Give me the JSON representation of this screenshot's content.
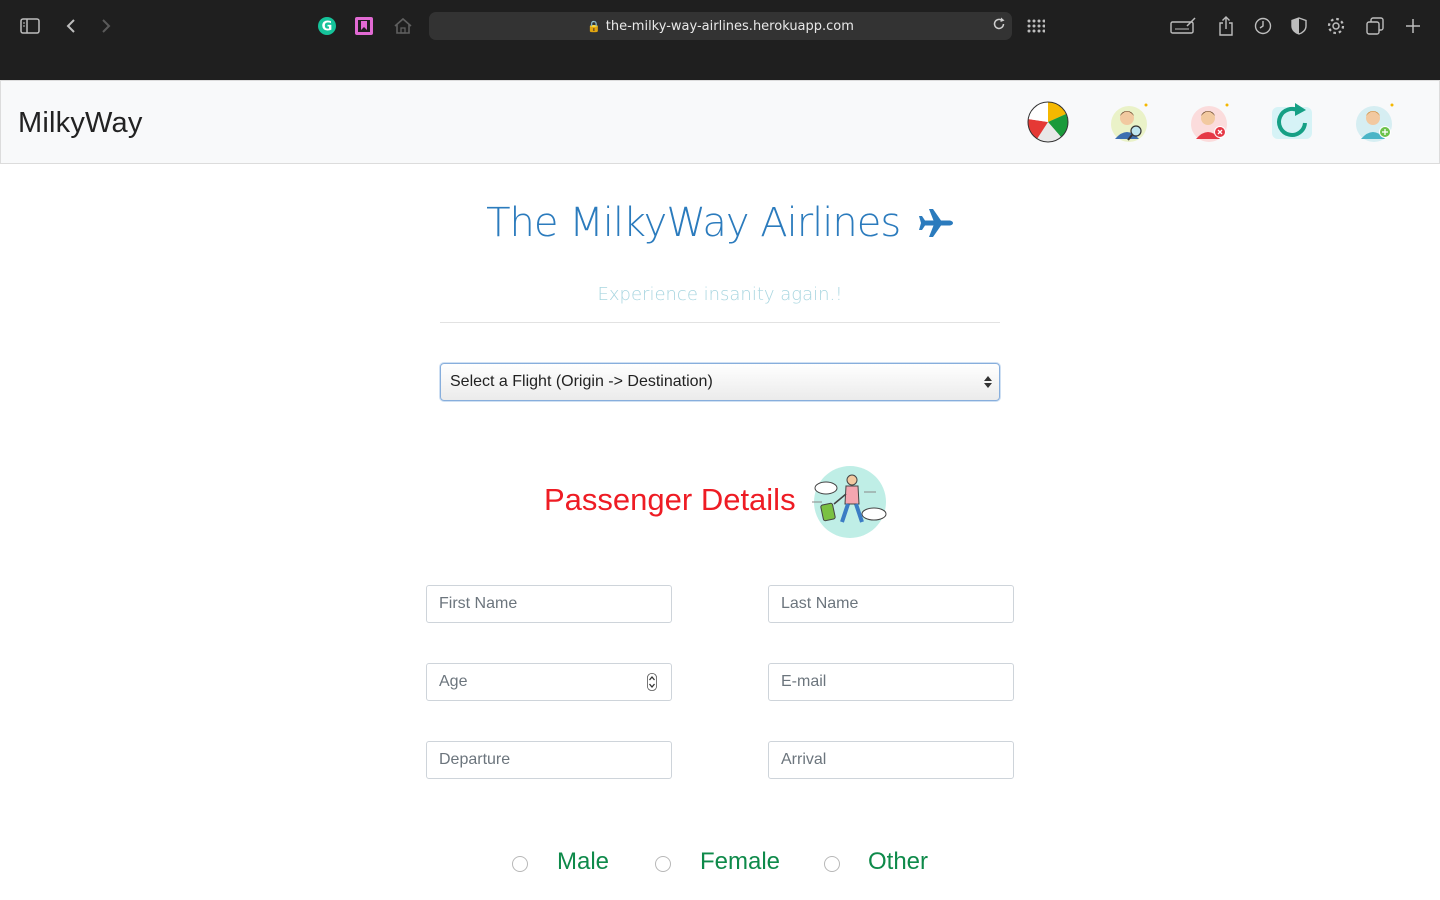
{
  "browser": {
    "url": "the-milky-way-airlines.herokuapp.com",
    "lock_glyph": "🔒",
    "icons": [
      "sidebar-icon",
      "back-icon",
      "forward-icon",
      "grammarly-icon",
      "bookmark-icon",
      "home-icon",
      "reload-icon",
      "grid-icon",
      "keyboard-icon",
      "share-icon",
      "history-icon",
      "shield-icon",
      "gear-icon",
      "tabs-icon",
      "plus-icon"
    ]
  },
  "navbar": {
    "brand": "MilkyWay",
    "icons": [
      "pie-chart-icon",
      "search-user-icon",
      "remove-user-icon",
      "refresh-icon",
      "add-user-icon"
    ]
  },
  "hero": {
    "title": "The MilkyWay Airlines",
    "tagline": "Experience insanity again.!"
  },
  "flight_select": {
    "selected": "Select a Flight (Origin -> Destination)"
  },
  "passenger": {
    "title": "Passenger Details",
    "fields": {
      "first_name": "First Name",
      "last_name": "Last Name",
      "age": "Age",
      "email": "E-mail",
      "departure": "Departure",
      "arrival": "Arrival"
    },
    "gender_options": [
      "Male",
      "Female",
      "Other"
    ]
  },
  "colors": {
    "accent_blue": "#2b7bbd",
    "tagline": "#a9d6e0",
    "section_red": "#ee1c24",
    "radio_green": "#0e8a4a"
  }
}
